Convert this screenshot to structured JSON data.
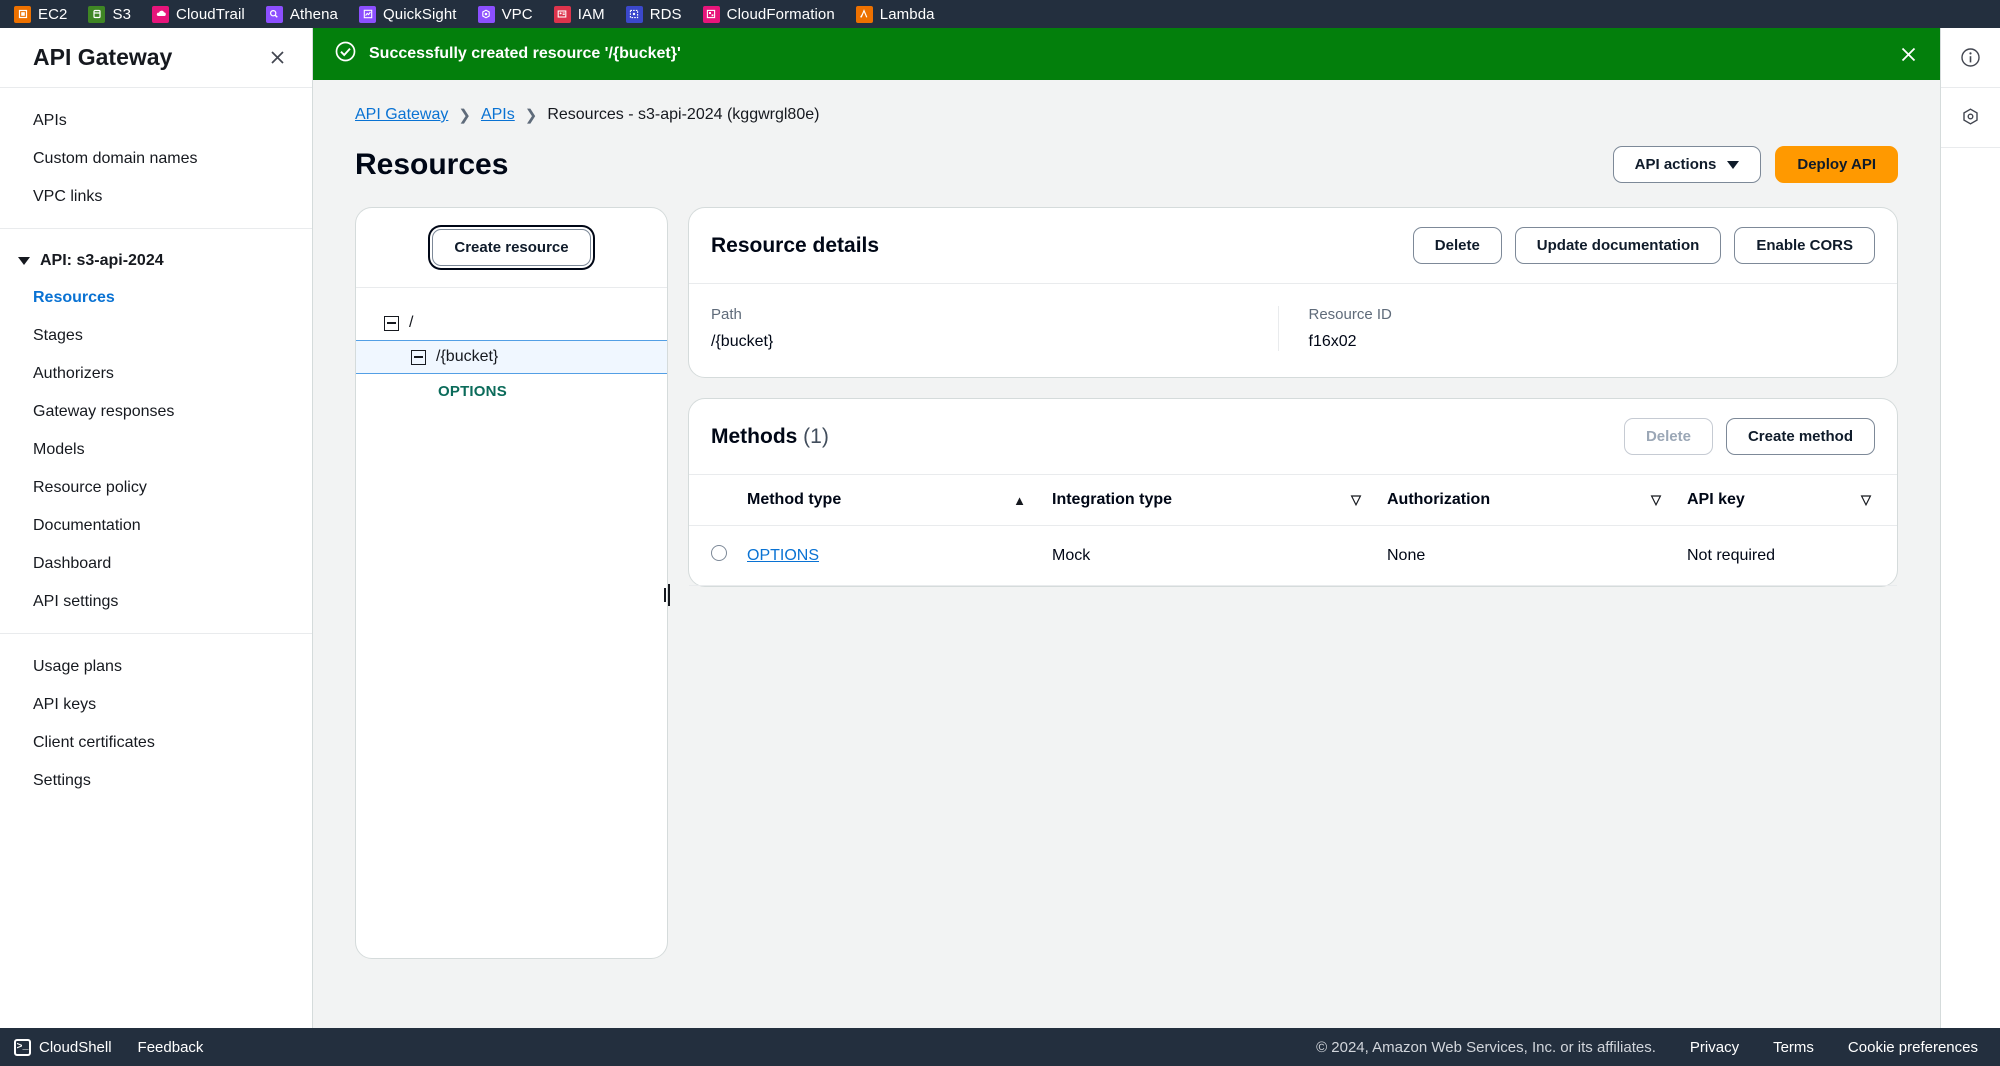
{
  "service_bar": {
    "items": [
      {
        "label": "EC2",
        "icon": "ec2-icon",
        "color": "#ed7100"
      },
      {
        "label": "S3",
        "icon": "s3-icon",
        "color": "#3f8624"
      },
      {
        "label": "CloudTrail",
        "icon": "cloudtrail-icon",
        "color": "#e7157b"
      },
      {
        "label": "Athena",
        "icon": "athena-icon",
        "color": "#8c4fff"
      },
      {
        "label": "QuickSight",
        "icon": "quicksight-icon",
        "color": "#8c4fff"
      },
      {
        "label": "VPC",
        "icon": "vpc-icon",
        "color": "#8c4fff"
      },
      {
        "label": "IAM",
        "icon": "iam-icon",
        "color": "#dd344c"
      },
      {
        "label": "RDS",
        "icon": "rds-icon",
        "color": "#3b48cc"
      },
      {
        "label": "CloudFormation",
        "icon": "cloudformation-icon",
        "color": "#e7157b"
      },
      {
        "label": "Lambda",
        "icon": "lambda-icon",
        "color": "#ed7100"
      }
    ]
  },
  "sidebar": {
    "title": "API Gateway",
    "close_icon": "close-icon",
    "top_items": [
      {
        "label": "APIs"
      },
      {
        "label": "Custom domain names"
      },
      {
        "label": "VPC links"
      }
    ],
    "api_section": {
      "label": "API: s3-api-2024",
      "expanded": true,
      "items": [
        {
          "label": "Resources",
          "active": true
        },
        {
          "label": "Stages",
          "active": false
        },
        {
          "label": "Authorizers",
          "active": false
        },
        {
          "label": "Gateway responses",
          "active": false
        },
        {
          "label": "Models",
          "active": false
        },
        {
          "label": "Resource policy",
          "active": false
        },
        {
          "label": "Documentation",
          "active": false
        },
        {
          "label": "Dashboard",
          "active": false
        },
        {
          "label": "API settings",
          "active": false
        }
      ]
    },
    "bottom_items": [
      {
        "label": "Usage plans"
      },
      {
        "label": "API keys"
      },
      {
        "label": "Client certificates"
      },
      {
        "label": "Settings"
      }
    ]
  },
  "flash": {
    "message": "Successfully created resource '/{bucket}'",
    "type": "success",
    "color": "#037f0c",
    "icon": "check-circle-icon",
    "close_icon": "close-icon"
  },
  "breadcrumb": {
    "items": [
      {
        "label": "API Gateway",
        "link": true
      },
      {
        "label": "APIs",
        "link": true
      },
      {
        "label": "Resources - s3-api-2024 (kggwrgl80e)",
        "link": false
      }
    ]
  },
  "page": {
    "title": "Resources",
    "api_actions_label": "API actions",
    "deploy_label": "Deploy API",
    "deploy_color": "#ff9900"
  },
  "tree": {
    "create_resource_label": "Create resource",
    "nodes": [
      {
        "label": "/",
        "level": 1,
        "type": "resource",
        "expanded": true,
        "selected": false
      },
      {
        "label": "/{bucket}",
        "level": 2,
        "type": "resource",
        "expanded": true,
        "selected": true
      },
      {
        "label": "OPTIONS",
        "level": 3,
        "type": "method",
        "selected": false
      }
    ]
  },
  "resource_details": {
    "title": "Resource details",
    "actions": [
      {
        "label": "Delete"
      },
      {
        "label": "Update documentation"
      },
      {
        "label": "Enable CORS"
      }
    ],
    "fields": [
      {
        "label": "Path",
        "value": "/{bucket}"
      },
      {
        "label": "Resource ID",
        "value": "f16x02"
      }
    ]
  },
  "methods": {
    "title": "Methods",
    "count": "(1)",
    "delete_label": "Delete",
    "delete_disabled": true,
    "create_label": "Create method",
    "columns": [
      {
        "label": "Method type",
        "sort": "asc"
      },
      {
        "label": "Integration type",
        "sort": "none"
      },
      {
        "label": "Authorization",
        "sort": "none"
      },
      {
        "label": "API key",
        "sort": "none"
      }
    ],
    "rows": [
      {
        "selected": false,
        "method_type": "OPTIONS",
        "integration_type": "Mock",
        "authorization": "None",
        "api_key": "Not required"
      }
    ]
  },
  "right_rail": {
    "items": [
      {
        "icon": "info-icon"
      },
      {
        "icon": "settings-icon"
      }
    ]
  },
  "footer": {
    "cloudshell_label": "CloudShell",
    "feedback_label": "Feedback",
    "copyright": "© 2024, Amazon Web Services, Inc. or its affiliates.",
    "links": [
      {
        "label": "Privacy"
      },
      {
        "label": "Terms"
      },
      {
        "label": "Cookie preferences"
      }
    ]
  }
}
